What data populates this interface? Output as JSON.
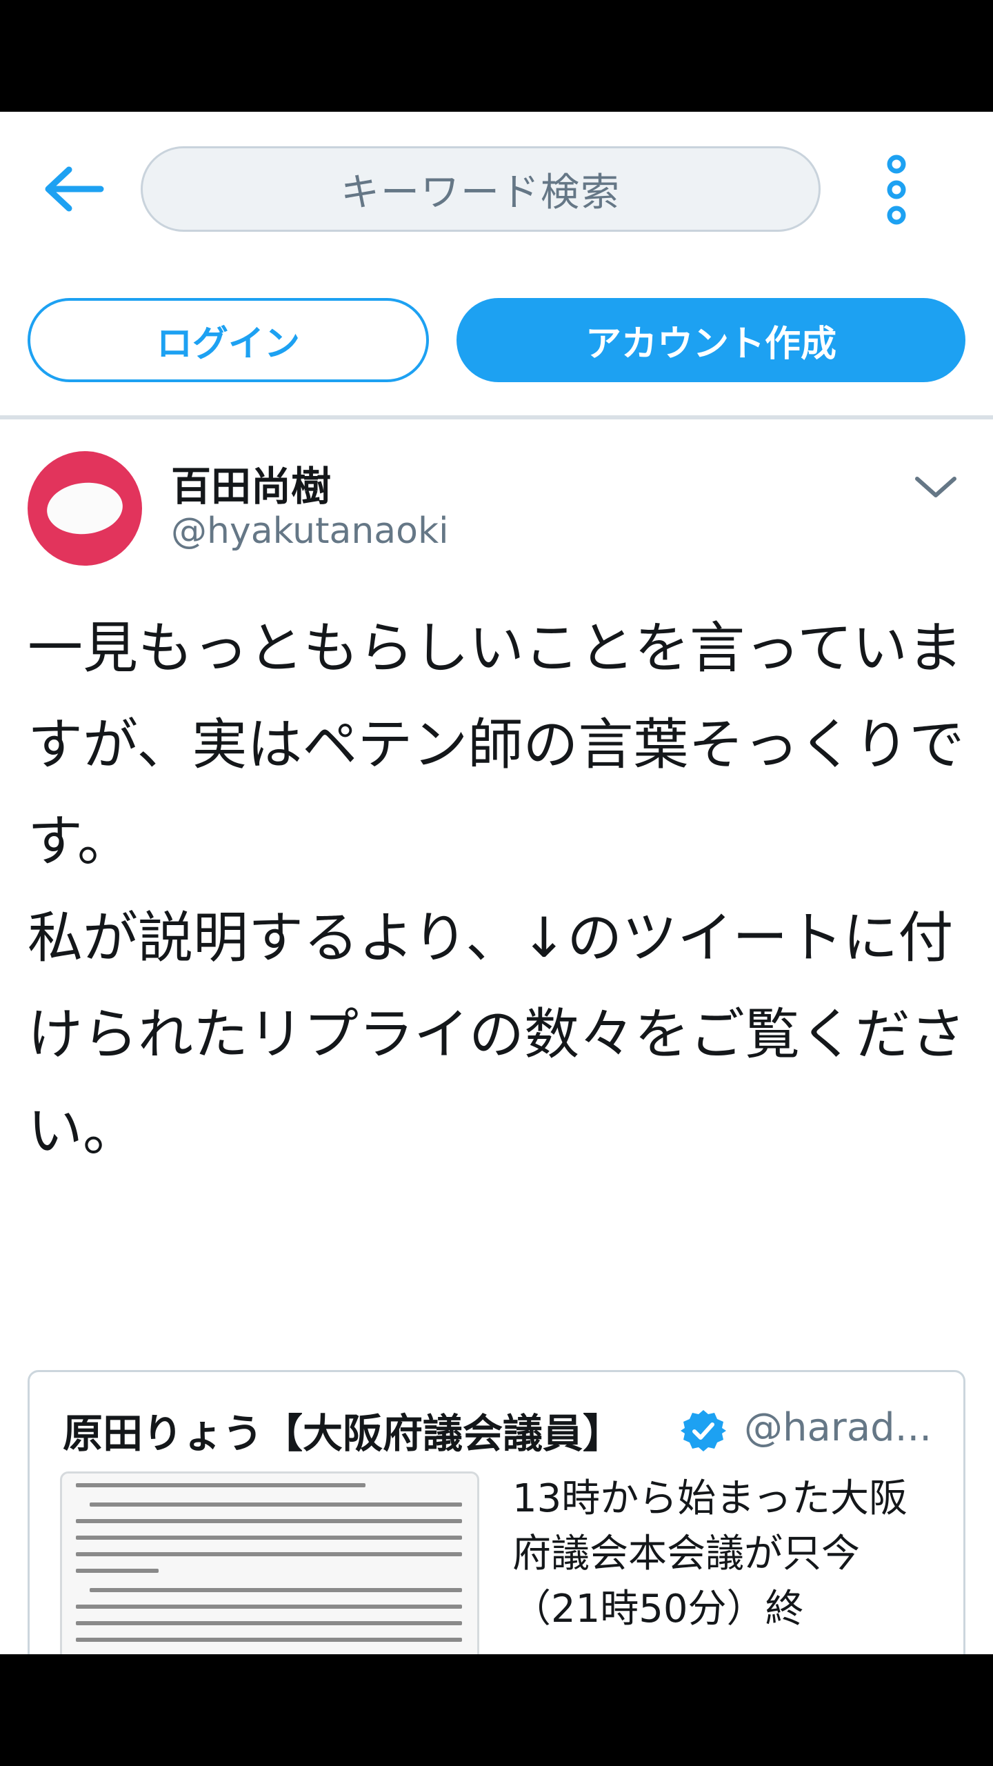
{
  "search": {
    "placeholder": "キーワード検索"
  },
  "auth": {
    "login_label": "ログイン",
    "signup_label": "アカウント作成"
  },
  "tweet": {
    "author_name": "百田尚樹",
    "author_handle": "@hyakutanaoki",
    "text": "一見もっともらしいことを言っていますが、実はペテン師の言葉そっくりです。\n私が説明するより、↓のツイートに付けられたリプライの数々をご覧ください。"
  },
  "quoted_tweet": {
    "author_name": "原田りょう【大阪府議会議員】",
    "author_handle": "@harad...",
    "text": "13時から始まった大阪府議会本会議が只今（21時50分）終"
  },
  "colors": {
    "accent": "#1da1f2",
    "avatar": "#e2345c",
    "text_primary": "#14171a",
    "text_secondary": "#657786"
  },
  "icons": {
    "back": "back-arrow-icon",
    "more": "more-vertical-icon",
    "caret": "chevron-down-icon",
    "verified": "verified-badge-icon"
  }
}
